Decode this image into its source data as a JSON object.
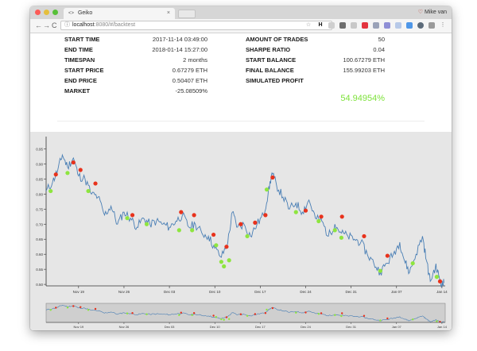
{
  "browser": {
    "tab_title": "Geiko",
    "tab_close": "×",
    "user_name": "Mike van",
    "url_host": "localhost",
    "url_rest": ":8080/#/backtest",
    "nav": {
      "back": "←",
      "forward": "→",
      "reload": "C"
    }
  },
  "stats": {
    "left": [
      {
        "label": "START TIME",
        "value": "2017-11-14 03:49:00"
      },
      {
        "label": "END TIME",
        "value": "2018-01-14 15:27:00"
      },
      {
        "label": "TIMESPAN",
        "value": "2 months"
      },
      {
        "label": "START PRICE",
        "value": "0.67279 ETH"
      },
      {
        "label": "END PRICE",
        "value": "0.50407 ETH"
      },
      {
        "label": "MARKET",
        "value": "-25.08509%"
      }
    ],
    "right": [
      {
        "label": "AMOUNT OF TRADES",
        "value": "50"
      },
      {
        "label": "SHARPE RATIO",
        "value": "0.04"
      },
      {
        "label": "START BALANCE",
        "value": "100.67279 ETH"
      },
      {
        "label": "FINAL BALANCE",
        "value": "155.99203 ETH"
      },
      {
        "label": "SIMULATED PROFIT",
        "value": ""
      }
    ],
    "simulated_profit": "54.94954%"
  },
  "colors": {
    "line": "#4a7fb5",
    "buy": "#8ee53f",
    "sell": "#e8321c",
    "profit": "#7ee23b",
    "chart_bg": "#e6e6e6"
  },
  "chart_data": {
    "type": "line",
    "y_ticks": [
      "0.50",
      "0.55",
      "0.60",
      "0.65",
      "0.70",
      "0.75",
      "0.80",
      "0.85",
      "0.90",
      "0.95"
    ],
    "ylim": [
      0.495,
      0.975
    ],
    "x_ticks": [
      "Nov 19",
      "Nov 26",
      "Dec 03",
      "Dec 10",
      "Dec 17",
      "Dec 24",
      "Dec 31",
      "Jan 07",
      "Jan 14"
    ],
    "x_tick_days": [
      5,
      12,
      19,
      26,
      33,
      40,
      47,
      54,
      61
    ],
    "x_range_days": [
      0,
      61.5
    ],
    "price_keypoints": [
      [
        0,
        0.81
      ],
      [
        1.0,
        0.84
      ],
      [
        1.8,
        0.88
      ],
      [
        2.5,
        0.93
      ],
      [
        3.3,
        0.89
      ],
      [
        4.2,
        0.92
      ],
      [
        5.0,
        0.86
      ],
      [
        6.0,
        0.85
      ],
      [
        7.0,
        0.8
      ],
      [
        8.0,
        0.79
      ],
      [
        9.0,
        0.73
      ],
      [
        10.0,
        0.76
      ],
      [
        11.0,
        0.7
      ],
      [
        12.0,
        0.74
      ],
      [
        13.0,
        0.72
      ],
      [
        14.0,
        0.69
      ],
      [
        15.0,
        0.72
      ],
      [
        16.0,
        0.7
      ],
      [
        17.0,
        0.71
      ],
      [
        18.0,
        0.7
      ],
      [
        19.0,
        0.69
      ],
      [
        20.0,
        0.71
      ],
      [
        21.0,
        0.73
      ],
      [
        22.0,
        0.69
      ],
      [
        23.0,
        0.7
      ],
      [
        24.0,
        0.67
      ],
      [
        25.0,
        0.66
      ],
      [
        26.0,
        0.62
      ],
      [
        27.0,
        0.59
      ],
      [
        28.0,
        0.64
      ],
      [
        28.7,
        0.74
      ],
      [
        29.5,
        0.69
      ],
      [
        30.5,
        0.7
      ],
      [
        31.5,
        0.66
      ],
      [
        32.5,
        0.7
      ],
      [
        33.5,
        0.73
      ],
      [
        34.2,
        0.8
      ],
      [
        34.8,
        0.87
      ],
      [
        35.5,
        0.83
      ],
      [
        36.5,
        0.79
      ],
      [
        37.5,
        0.75
      ],
      [
        38.5,
        0.77
      ],
      [
        39.5,
        0.74
      ],
      [
        40.5,
        0.78
      ],
      [
        41.5,
        0.72
      ],
      [
        42.5,
        0.71
      ],
      [
        43.5,
        0.66
      ],
      [
        44.5,
        0.7
      ],
      [
        45.5,
        0.67
      ],
      [
        46.5,
        0.66
      ],
      [
        47.5,
        0.65
      ],
      [
        48.5,
        0.64
      ],
      [
        49.5,
        0.6
      ],
      [
        50.5,
        0.57
      ],
      [
        51.5,
        0.54
      ],
      [
        52.5,
        0.57
      ],
      [
        53.5,
        0.6
      ],
      [
        54.5,
        0.64
      ],
      [
        55.2,
        0.58
      ],
      [
        56.0,
        0.54
      ],
      [
        57.0,
        0.6
      ],
      [
        58.0,
        0.66
      ],
      [
        58.6,
        0.58
      ],
      [
        59.2,
        0.51
      ],
      [
        60.0,
        0.56
      ],
      [
        60.5,
        0.53
      ],
      [
        61.0,
        0.5
      ],
      [
        61.3,
        0.505
      ]
    ],
    "noise_seed": 11,
    "buys": [
      [
        0.7,
        0.81
      ],
      [
        3.3,
        0.87
      ],
      [
        6.5,
        0.81
      ],
      [
        12.5,
        0.72
      ],
      [
        15.5,
        0.7
      ],
      [
        20.5,
        0.68
      ],
      [
        22.5,
        0.68
      ],
      [
        26.2,
        0.63
      ],
      [
        27.0,
        0.575
      ],
      [
        27.4,
        0.56
      ],
      [
        28.2,
        0.58
      ],
      [
        31.0,
        0.66
      ],
      [
        34.0,
        0.815
      ],
      [
        38.5,
        0.74
      ],
      [
        42.0,
        0.71
      ],
      [
        44.5,
        0.68
      ],
      [
        45.5,
        0.655
      ],
      [
        51.5,
        0.545
      ],
      [
        56.5,
        0.57
      ],
      [
        60.2,
        0.525
      ]
    ],
    "sells": [
      [
        1.5,
        0.865
      ],
      [
        4.2,
        0.905
      ],
      [
        5.3,
        0.88
      ],
      [
        7.6,
        0.835
      ],
      [
        13.3,
        0.73
      ],
      [
        20.8,
        0.74
      ],
      [
        22.8,
        0.73
      ],
      [
        25.8,
        0.665
      ],
      [
        27.8,
        0.625
      ],
      [
        30.0,
        0.7
      ],
      [
        32.2,
        0.705
      ],
      [
        33.8,
        0.73
      ],
      [
        34.9,
        0.855
      ],
      [
        40.0,
        0.745
      ],
      [
        42.4,
        0.725
      ],
      [
        45.6,
        0.725
      ],
      [
        49.0,
        0.66
      ],
      [
        52.6,
        0.595
      ],
      [
        60.7,
        0.51
      ]
    ]
  }
}
